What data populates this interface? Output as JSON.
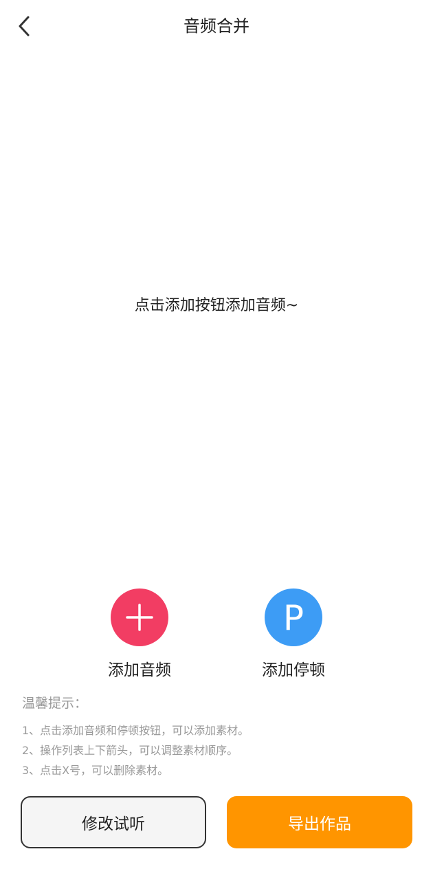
{
  "header": {
    "title": "音频合并",
    "back_icon": "chevron-left-icon"
  },
  "main": {
    "empty_hint": "点击添加按钮添加音频~"
  },
  "actions": {
    "add_audio": {
      "label": "添加音频",
      "icon": "plus-icon",
      "color": "#f23d63"
    },
    "add_pause": {
      "label": "添加停顿",
      "icon_letter": "P",
      "color": "#3d9cf5"
    }
  },
  "tips": {
    "title": "温馨提示：",
    "items": [
      "1、点击添加音频和停顿按钮，可以添加素材。",
      "2、操作列表上下箭头，可以调整素材顺序。",
      "3、点击X号，可以删除素材。"
    ]
  },
  "footer": {
    "preview_label": "修改试听",
    "export_label": "导出作品",
    "export_color": "#ff9500"
  }
}
